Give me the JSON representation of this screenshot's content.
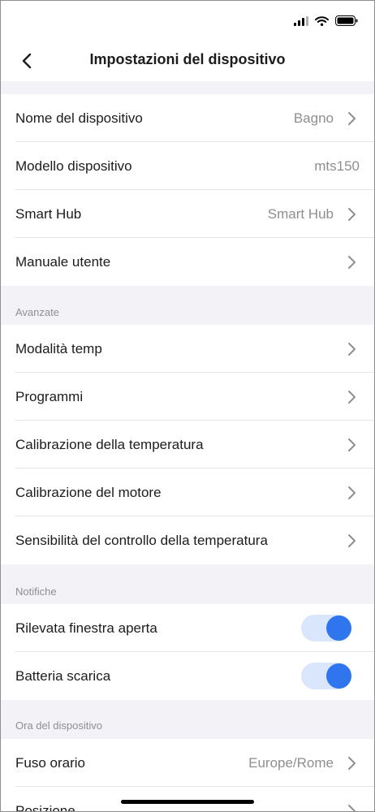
{
  "header": {
    "title": "Impostazioni del dispositivo"
  },
  "info": [
    {
      "label": "Nome del dispositivo",
      "value": "Bagno",
      "chevron": true
    },
    {
      "label": "Modello dispositivo",
      "value": "mts150",
      "chevron": false
    },
    {
      "label": "Smart Hub",
      "value": "Smart Hub",
      "chevron": true
    },
    {
      "label": "Manuale utente",
      "value": "",
      "chevron": true
    }
  ],
  "advanced": {
    "title": "Avanzate",
    "items": [
      {
        "label": "Modalità temp"
      },
      {
        "label": "Programmi"
      },
      {
        "label": "Calibrazione della temperatura"
      },
      {
        "label": "Calibrazione del motore"
      },
      {
        "label": "Sensibilità del controllo della temperatura"
      }
    ]
  },
  "notifications": {
    "title": "Notifiche",
    "items": [
      {
        "label": "Rilevata finestra aperta",
        "enabled": true
      },
      {
        "label": "Batteria scarica",
        "enabled": true
      }
    ]
  },
  "device_time": {
    "title": "Ora del dispositivo",
    "items": [
      {
        "label": "Fuso orario",
        "value": "Europe/Rome"
      },
      {
        "label": "Posizione",
        "value": ""
      }
    ]
  },
  "colors": {
    "accent": "#2f76ee",
    "toggle_track": "#d9e6fb",
    "background": "#f2f2f7"
  }
}
